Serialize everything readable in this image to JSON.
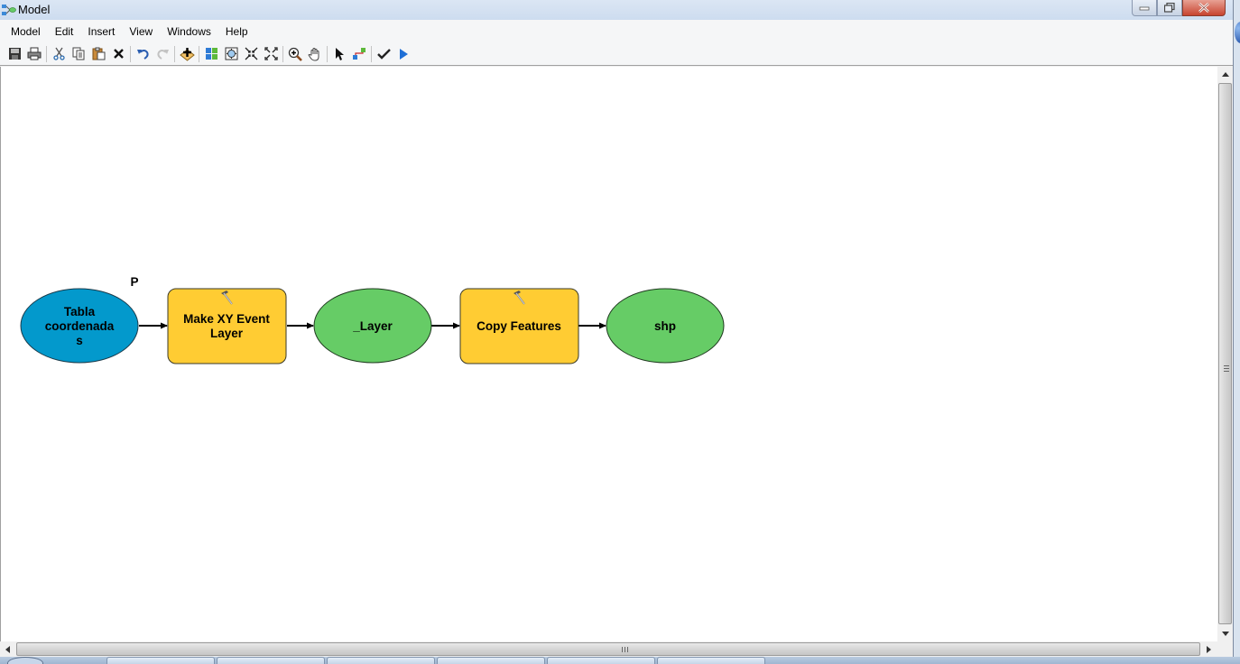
{
  "window": {
    "title": "Model",
    "controls": [
      "minimize",
      "restore",
      "close"
    ]
  },
  "menubar": {
    "items": [
      "Model",
      "Edit",
      "Insert",
      "View",
      "Windows",
      "Help"
    ]
  },
  "toolbar": {
    "buttons": [
      {
        "name": "save",
        "icon": "save-icon"
      },
      {
        "name": "print",
        "icon": "print-icon"
      },
      {
        "name": "cut",
        "icon": "cut-icon"
      },
      {
        "name": "copy",
        "icon": "copy-icon"
      },
      {
        "name": "paste",
        "icon": "paste-icon"
      },
      {
        "name": "delete",
        "icon": "delete-icon"
      },
      {
        "name": "undo",
        "icon": "undo-icon"
      },
      {
        "name": "redo",
        "icon": "redo-icon"
      },
      {
        "name": "add-data",
        "icon": "add-data-icon"
      },
      {
        "name": "auto-layout",
        "icon": "auto-layout-icon"
      },
      {
        "name": "full-extent",
        "icon": "full-extent-icon"
      },
      {
        "name": "zoom-in-fixed",
        "icon": "fixed-zoom-in-icon"
      },
      {
        "name": "zoom-out-fixed",
        "icon": "fixed-zoom-out-icon"
      },
      {
        "name": "zoom",
        "icon": "magnifier-icon"
      },
      {
        "name": "pan",
        "icon": "pan-hand-icon"
      },
      {
        "name": "select",
        "icon": "select-arrow-icon"
      },
      {
        "name": "connect",
        "icon": "connect-icon"
      },
      {
        "name": "validate",
        "icon": "checkmark-icon"
      },
      {
        "name": "run",
        "icon": "run-icon"
      }
    ]
  },
  "colors": {
    "input_variable": "#0399cc",
    "tool": "#ffcc33",
    "derived_data": "#66cc66",
    "connector": "#000000"
  },
  "model": {
    "nodes": [
      {
        "id": "tabla",
        "type": "input",
        "label_lines": [
          "Tabla",
          "coordenada",
          "s"
        ],
        "parameter_marker": "P"
      },
      {
        "id": "make-xy",
        "type": "tool",
        "label_lines": [
          "Make XY Event",
          "Layer"
        ]
      },
      {
        "id": "layer",
        "type": "derived",
        "label_lines": [
          "_Layer"
        ]
      },
      {
        "id": "copy-features",
        "type": "tool",
        "label_lines": [
          "Copy Features"
        ]
      },
      {
        "id": "shp",
        "type": "derived",
        "label_lines": [
          "shp"
        ]
      }
    ]
  }
}
